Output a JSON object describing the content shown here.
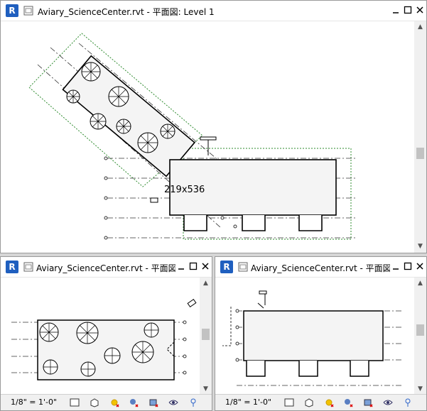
{
  "app": {
    "logo_letter": "R"
  },
  "main_view": {
    "title": "Aviary_ScienceCenter.rvt - 平面図: Level 1",
    "dimension_label": "219x536"
  },
  "bottom_left_view": {
    "title": "Aviary_ScienceCenter.rvt - 平面図: L...",
    "scale": "1/8\" = 1'-0\""
  },
  "bottom_right_view": {
    "title": "Aviary_ScienceCenter.rvt - 平面図: L...",
    "scale": "1/8\" = 1'-0\""
  },
  "status_icons": [
    "detail-level-icon",
    "visual-style-icon",
    "sun-path-icon",
    "shadows-icon",
    "crop-view-icon",
    "hide-crop-icon",
    "temporary-hide-icon",
    "reveal-hidden-icon"
  ],
  "colors": {
    "accent": "#1f5fbf",
    "crop_region": "#2e8b2e"
  }
}
